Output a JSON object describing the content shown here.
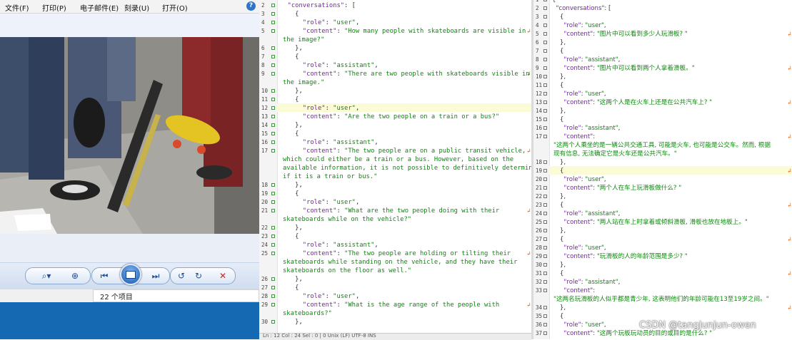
{
  "viewer": {
    "menu": [
      "文件(F)",
      "打印(P)",
      "电子邮件(E)",
      "刻录(U)",
      "打开(O)"
    ],
    "help_icon": "?",
    "status_text": "22 个项目",
    "toolbar_icons": [
      "zoom-icon",
      "fit-icon",
      "previous-icon",
      "slideshow-icon",
      "next-icon",
      "rotate-ccw-icon",
      "rotate-cw-icon",
      "delete-icon"
    ],
    "zoom_glyph": "⌕▾",
    "fit_glyph": "⊕",
    "prev_glyph": "⏮",
    "next_glyph": "⏭",
    "rotate_ccw_glyph": "↺",
    "rotate_cw_glyph": "↻",
    "delete_glyph": "✕",
    "colors": {
      "accent": "#1569b3",
      "delete": "#d42020"
    }
  },
  "left_editor": {
    "lines": [
      {
        "n": "2",
        "t": [
          [
            "  ",
            "p"
          ],
          [
            "\"conversations\"",
            "k"
          ],
          [
            ": [",
            "p"
          ]
        ]
      },
      {
        "n": "3",
        "t": [
          [
            "    {",
            "p"
          ]
        ]
      },
      {
        "n": "4",
        "t": [
          [
            "      ",
            "p"
          ],
          [
            "\"role\"",
            "k"
          ],
          [
            ": ",
            "p"
          ],
          [
            "\"user\"",
            "s"
          ],
          [
            ",",
            "p"
          ]
        ]
      },
      {
        "n": "5",
        "t": [
          [
            "      ",
            "p"
          ],
          [
            "\"content\"",
            "k"
          ],
          [
            ": ",
            "p"
          ],
          [
            "\"How many people with skateboards are visible in",
            "s"
          ]
        ]
      },
      {
        "n": "",
        "t": [
          [
            "the image?\"",
            "s"
          ]
        ]
      },
      {
        "n": "6",
        "t": [
          [
            "    },",
            "p"
          ]
        ]
      },
      {
        "n": "7",
        "t": [
          [
            "    {",
            "p"
          ]
        ]
      },
      {
        "n": "8",
        "t": [
          [
            "      ",
            "p"
          ],
          [
            "\"role\"",
            "k"
          ],
          [
            ": ",
            "p"
          ],
          [
            "\"assistant\"",
            "s"
          ],
          [
            ",",
            "p"
          ]
        ]
      },
      {
        "n": "9",
        "t": [
          [
            "      ",
            "p"
          ],
          [
            "\"content\"",
            "k"
          ],
          [
            ": ",
            "p"
          ],
          [
            "\"There are two people with skateboards visible in",
            "s"
          ]
        ]
      },
      {
        "n": "",
        "t": [
          [
            "the image.\"",
            "s"
          ]
        ]
      },
      {
        "n": "10",
        "t": [
          [
            "    },",
            "p"
          ]
        ]
      },
      {
        "n": "11",
        "t": [
          [
            "    {",
            "p"
          ]
        ]
      },
      {
        "n": "12",
        "t": [
          [
            "      ",
            "p"
          ],
          [
            "\"role\"",
            "k"
          ],
          [
            ": ",
            "p"
          ],
          [
            "\"user\"",
            "s"
          ],
          [
            ",",
            "p"
          ]
        ]
      },
      {
        "n": "13",
        "t": [
          [
            "      ",
            "p"
          ],
          [
            "\"content\"",
            "k"
          ],
          [
            ": ",
            "p"
          ],
          [
            "\"Are the two people on a train or a bus?\"",
            "s"
          ]
        ]
      },
      {
        "n": "14",
        "t": [
          [
            "    },",
            "p"
          ]
        ]
      },
      {
        "n": "15",
        "t": [
          [
            "    {",
            "p"
          ]
        ]
      },
      {
        "n": "16",
        "t": [
          [
            "      ",
            "p"
          ],
          [
            "\"role\"",
            "k"
          ],
          [
            ": ",
            "p"
          ],
          [
            "\"assistant\"",
            "s"
          ],
          [
            ",",
            "p"
          ]
        ]
      },
      {
        "n": "17",
        "t": [
          [
            "      ",
            "p"
          ],
          [
            "\"content\"",
            "k"
          ],
          [
            ": ",
            "p"
          ],
          [
            "\"The two people are on a public transit vehicle,",
            "s"
          ]
        ]
      },
      {
        "n": "",
        "t": [
          [
            "which could either be a train or a bus. However, based on the",
            "s"
          ]
        ]
      },
      {
        "n": "",
        "t": [
          [
            "available information, it is not possible to definitively determine",
            "s"
          ]
        ]
      },
      {
        "n": "",
        "t": [
          [
            "if it is a train or bus.\"",
            "s"
          ]
        ]
      },
      {
        "n": "18",
        "t": [
          [
            "    },",
            "p"
          ]
        ]
      },
      {
        "n": "19",
        "t": [
          [
            "    {",
            "p"
          ]
        ]
      },
      {
        "n": "20",
        "t": [
          [
            "      ",
            "p"
          ],
          [
            "\"role\"",
            "k"
          ],
          [
            ": ",
            "p"
          ],
          [
            "\"user\"",
            "s"
          ],
          [
            ",",
            "p"
          ]
        ]
      },
      {
        "n": "21",
        "t": [
          [
            "      ",
            "p"
          ],
          [
            "\"content\"",
            "k"
          ],
          [
            ": ",
            "p"
          ],
          [
            "\"What are the two people doing with their",
            "s"
          ]
        ]
      },
      {
        "n": "",
        "t": [
          [
            "skateboards while on the vehicle?\"",
            "s"
          ]
        ]
      },
      {
        "n": "22",
        "t": [
          [
            "    },",
            "p"
          ]
        ]
      },
      {
        "n": "23",
        "t": [
          [
            "    {",
            "p"
          ]
        ]
      },
      {
        "n": "24",
        "t": [
          [
            "      ",
            "p"
          ],
          [
            "\"role\"",
            "k"
          ],
          [
            ": ",
            "p"
          ],
          [
            "\"assistant\"",
            "s"
          ],
          [
            ",",
            "p"
          ]
        ]
      },
      {
        "n": "25",
        "t": [
          [
            "      ",
            "p"
          ],
          [
            "\"content\"",
            "k"
          ],
          [
            ": ",
            "p"
          ],
          [
            "\"The two people are holding or tilting their",
            "s"
          ]
        ]
      },
      {
        "n": "",
        "t": [
          [
            "skateboards while standing on the vehicle, and they have their",
            "s"
          ]
        ]
      },
      {
        "n": "",
        "t": [
          [
            "skateboards on the floor as well.\"",
            "s"
          ]
        ]
      },
      {
        "n": "26",
        "t": [
          [
            "    },",
            "p"
          ]
        ]
      },
      {
        "n": "27",
        "t": [
          [
            "    {",
            "p"
          ]
        ]
      },
      {
        "n": "28",
        "t": [
          [
            "      ",
            "p"
          ],
          [
            "\"role\"",
            "k"
          ],
          [
            ": ",
            "p"
          ],
          [
            "\"user\"",
            "s"
          ],
          [
            ",",
            "p"
          ]
        ]
      },
      {
        "n": "29",
        "t": [
          [
            "      ",
            "p"
          ],
          [
            "\"content\"",
            "k"
          ],
          [
            ": ",
            "p"
          ],
          [
            "\"What is the age range of the people with",
            "s"
          ]
        ]
      },
      {
        "n": "",
        "t": [
          [
            "skateboards?\"",
            "s"
          ]
        ]
      },
      {
        "n": "30",
        "t": [
          [
            "    },",
            "p"
          ]
        ]
      }
    ],
    "bottom_text": "Ln : 12   Col : 24   Sel : 0 | 0      Unix (LF)      UTF-8      INS"
  },
  "right_editor": {
    "lines": [
      {
        "n": "1",
        "t": [
          [
            "{",
            "p"
          ]
        ]
      },
      {
        "n": "2",
        "t": [
          [
            "  ",
            "p"
          ],
          [
            "\"conversations\"",
            "k"
          ],
          [
            ": [",
            "p"
          ]
        ]
      },
      {
        "n": "3",
        "t": [
          [
            "    {",
            "p"
          ]
        ]
      },
      {
        "n": "4",
        "t": [
          [
            "      ",
            "p"
          ],
          [
            "\"role\"",
            "k"
          ],
          [
            ": ",
            "p"
          ],
          [
            "\"user\"",
            "s"
          ],
          [
            ",",
            "p"
          ]
        ]
      },
      {
        "n": "5",
        "t": [
          [
            "      ",
            "p"
          ],
          [
            "\"content\"",
            "k"
          ],
          [
            ": ",
            "p"
          ],
          [
            "\"图片中可以看到多少人玩滑板? \"",
            "s"
          ]
        ]
      },
      {
        "n": "6",
        "t": [
          [
            "    },",
            "p"
          ]
        ]
      },
      {
        "n": "7",
        "t": [
          [
            "    {",
            "p"
          ]
        ]
      },
      {
        "n": "8",
        "t": [
          [
            "      ",
            "p"
          ],
          [
            "\"role\"",
            "k"
          ],
          [
            ": ",
            "p"
          ],
          [
            "\"assistant\"",
            "s"
          ],
          [
            ",",
            "p"
          ]
        ]
      },
      {
        "n": "9",
        "t": [
          [
            "      ",
            "p"
          ],
          [
            "\"content\"",
            "k"
          ],
          [
            ": ",
            "p"
          ],
          [
            "\"图片中可以看到两个人拿着滑板。\"",
            "s"
          ]
        ]
      },
      {
        "n": "10",
        "t": [
          [
            "    },",
            "p"
          ]
        ]
      },
      {
        "n": "11",
        "t": [
          [
            "    {",
            "p"
          ]
        ]
      },
      {
        "n": "12",
        "t": [
          [
            "      ",
            "p"
          ],
          [
            "\"role\"",
            "k"
          ],
          [
            ": ",
            "p"
          ],
          [
            "\"user\"",
            "s"
          ],
          [
            ",",
            "p"
          ]
        ]
      },
      {
        "n": "13",
        "t": [
          [
            "      ",
            "p"
          ],
          [
            "\"content\"",
            "k"
          ],
          [
            ": ",
            "p"
          ],
          [
            "\"这两个人是在火车上还是在公共汽车上? \"",
            "s"
          ]
        ]
      },
      {
        "n": "14",
        "t": [
          [
            "    },",
            "p"
          ]
        ]
      },
      {
        "n": "15",
        "t": [
          [
            "    {",
            "p"
          ]
        ]
      },
      {
        "n": "16",
        "t": [
          [
            "      ",
            "p"
          ],
          [
            "\"role\"",
            "k"
          ],
          [
            ": ",
            "p"
          ],
          [
            "\"assistant\"",
            "s"
          ],
          [
            ",",
            "p"
          ]
        ]
      },
      {
        "n": "17",
        "t": [
          [
            "      ",
            "p"
          ],
          [
            "\"content\"",
            "k"
          ],
          [
            ":",
            "p"
          ]
        ]
      },
      {
        "n": "",
        "t": [
          [
            "\"这两个人乘坐的是一辆公共交通工具, 可能是火车, 也可能是公交车。然而, 根据",
            "s"
          ]
        ]
      },
      {
        "n": "",
        "t": [
          [
            "现有信息, 无法确定它是火车还是公共汽车。\"",
            "s"
          ]
        ]
      },
      {
        "n": "18",
        "t": [
          [
            "    },",
            "p"
          ]
        ]
      },
      {
        "n": "19",
        "t": [
          [
            "    {",
            "p"
          ]
        ]
      },
      {
        "n": "20",
        "t": [
          [
            "      ",
            "p"
          ],
          [
            "\"role\"",
            "k"
          ],
          [
            ": ",
            "p"
          ],
          [
            "\"user\"",
            "s"
          ],
          [
            ",",
            "p"
          ]
        ]
      },
      {
        "n": "21",
        "t": [
          [
            "      ",
            "p"
          ],
          [
            "\"content\"",
            "k"
          ],
          [
            ": ",
            "p"
          ],
          [
            "\"两个人在车上玩滑板做什么? \"",
            "s"
          ]
        ]
      },
      {
        "n": "22",
        "t": [
          [
            "    },",
            "p"
          ]
        ]
      },
      {
        "n": "23",
        "t": [
          [
            "    {",
            "p"
          ]
        ]
      },
      {
        "n": "24",
        "t": [
          [
            "      ",
            "p"
          ],
          [
            "\"role\"",
            "k"
          ],
          [
            ": ",
            "p"
          ],
          [
            "\"assistant\"",
            "s"
          ],
          [
            ",",
            "p"
          ]
        ]
      },
      {
        "n": "25",
        "t": [
          [
            "      ",
            "p"
          ],
          [
            "\"content\"",
            "k"
          ],
          [
            ": ",
            "p"
          ],
          [
            "\"两人站在车上时拿着或倾斜滑板, 滑板也放在地板上。\"",
            "s"
          ]
        ]
      },
      {
        "n": "26",
        "t": [
          [
            "    },",
            "p"
          ]
        ]
      },
      {
        "n": "27",
        "t": [
          [
            "    {",
            "p"
          ]
        ]
      },
      {
        "n": "28",
        "t": [
          [
            "      ",
            "p"
          ],
          [
            "\"role\"",
            "k"
          ],
          [
            ": ",
            "p"
          ],
          [
            "\"user\"",
            "s"
          ],
          [
            ",",
            "p"
          ]
        ]
      },
      {
        "n": "29",
        "t": [
          [
            "      ",
            "p"
          ],
          [
            "\"content\"",
            "k"
          ],
          [
            ": ",
            "p"
          ],
          [
            "\"玩滑板的人的年龄范围是多少? \"",
            "s"
          ]
        ]
      },
      {
        "n": "30",
        "t": [
          [
            "    },",
            "p"
          ]
        ]
      },
      {
        "n": "31",
        "t": [
          [
            "    {",
            "p"
          ]
        ]
      },
      {
        "n": "32",
        "t": [
          [
            "      ",
            "p"
          ],
          [
            "\"role\"",
            "k"
          ],
          [
            ": ",
            "p"
          ],
          [
            "\"assistant\"",
            "s"
          ],
          [
            ",",
            "p"
          ]
        ]
      },
      {
        "n": "33",
        "t": [
          [
            "      ",
            "p"
          ],
          [
            "\"content\"",
            "k"
          ],
          [
            ":",
            "p"
          ]
        ]
      },
      {
        "n": "",
        "t": [
          [
            "\"这两名玩滑板的人似乎都是青少年, 这表明他们的年龄可能在13至19岁之间。\"",
            "s"
          ]
        ]
      },
      {
        "n": "34",
        "t": [
          [
            "    },",
            "p"
          ]
        ]
      },
      {
        "n": "35",
        "t": [
          [
            "    {",
            "p"
          ]
        ]
      },
      {
        "n": "36",
        "t": [
          [
            "      ",
            "p"
          ],
          [
            "\"role\"",
            "k"
          ],
          [
            ": ",
            "p"
          ],
          [
            "\"user\"",
            "s"
          ],
          [
            ",",
            "p"
          ]
        ]
      },
      {
        "n": "37",
        "t": [
          [
            "      ",
            "p"
          ],
          [
            "\"content\"",
            "k"
          ],
          [
            ": ",
            "p"
          ],
          [
            "\"这两个玩板玩动员的目的或目的是什么? \"",
            "s"
          ]
        ]
      }
    ]
  },
  "watermark": "CSDN @tangjunjun-owen"
}
